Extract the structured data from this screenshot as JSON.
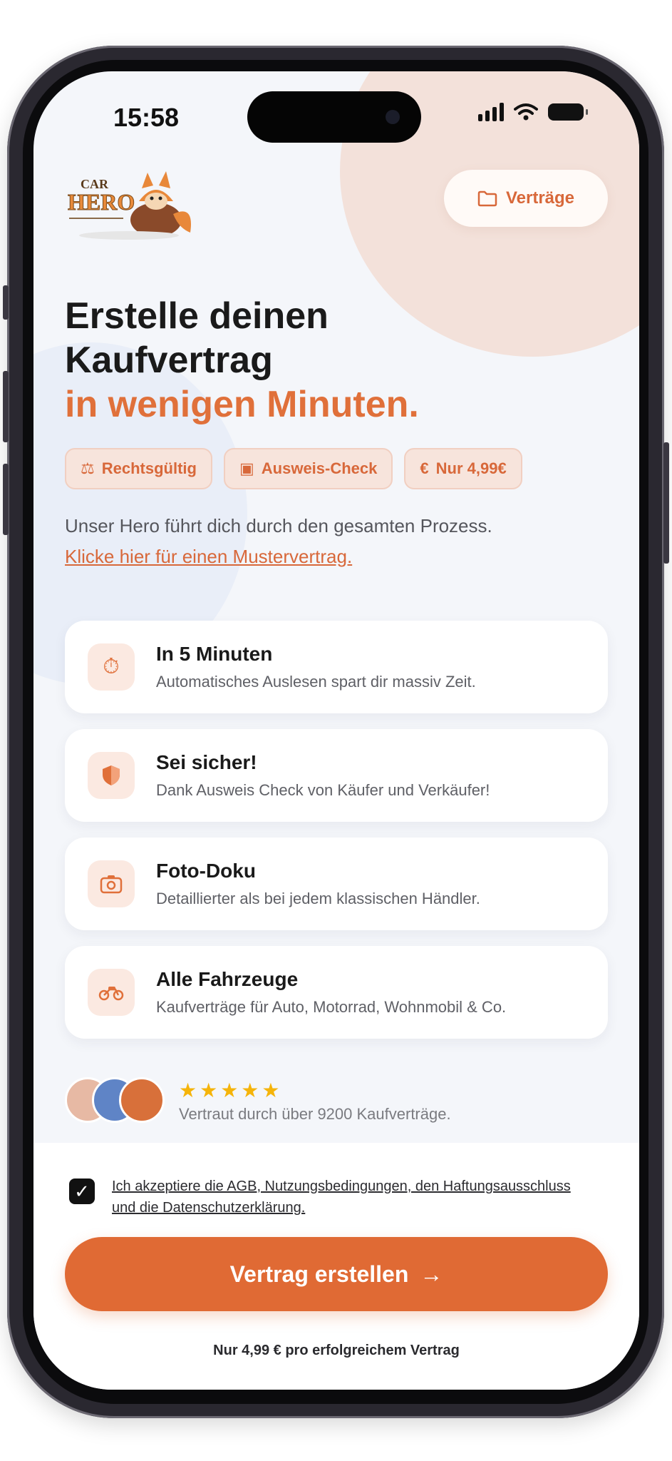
{
  "status_bar": {
    "time": "15:58"
  },
  "header": {
    "contracts_button_label": "Verträge",
    "contracts_icon": "folder-icon"
  },
  "hero": {
    "title_line1": "Erstelle deinen",
    "title_line2": "Kaufvertrag",
    "title_accent": "in wenigen Minuten."
  },
  "chips": [
    {
      "icon": "gavel-icon",
      "label": "Rechtsgültig"
    },
    {
      "icon": "id-card-icon",
      "label": "Ausweis-Check"
    },
    {
      "icon": "euro-icon",
      "label": "Nur 4,99€"
    }
  ],
  "intro": {
    "text": "Unser Hero führt dich durch den gesamten Prozess.",
    "link": "Klicke hier für einen Mustervertrag."
  },
  "features": [
    {
      "icon": "stopwatch-icon",
      "title": "In 5 Minuten",
      "desc": "Automatisches Auslesen spart dir massiv Zeit."
    },
    {
      "icon": "shield-icon",
      "title": "Sei sicher!",
      "desc": "Dank Ausweis Check von Käufer und Verkäufer!"
    },
    {
      "icon": "camera-icon",
      "title": "Foto-Doku",
      "desc": "Detaillierter als bei jedem klassischen Händler."
    },
    {
      "icon": "motorcycle-icon",
      "title": "Alle Fahrzeuge",
      "desc": "Kaufverträge für Auto, Motorrad, Wohnmobil & Co."
    }
  ],
  "trust": {
    "stars": "★★★★★",
    "rating": 5,
    "text": "Vertraut durch über 9200 Kaufverträge."
  },
  "accept": {
    "checked": true,
    "text": "Ich akzeptiere die AGB, Nutzungsbedingungen, den Haftungsausschluss und die Datenschutzerklärung."
  },
  "cta": {
    "label": "Vertrag erstellen",
    "arrow": "→"
  },
  "price_note": "Nur 4,99 € pro erfolgreichem Vertrag",
  "colors": {
    "accent": "#e06a34",
    "background": "#f4f6fa"
  }
}
